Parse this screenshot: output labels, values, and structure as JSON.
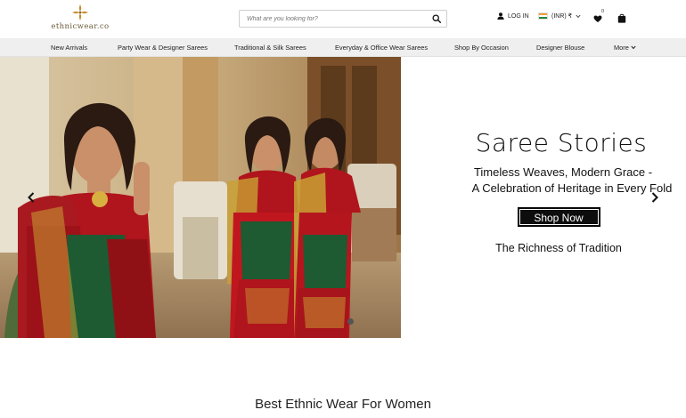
{
  "header": {
    "logo_text": "ethnicwear.co",
    "search_placeholder": "What are you looking for?",
    "login_label": "LOG IN",
    "currency_label": "(INR) ₹",
    "wishlist_count": "0",
    "icons": [
      "logo-mark",
      "search-icon",
      "user-icon",
      "india-flag-icon",
      "chevron-down-icon",
      "heart-icon",
      "shopping-bag-icon"
    ]
  },
  "nav": {
    "items": [
      {
        "label": "New Arrivals"
      },
      {
        "label": "Party Wear & Designer Sarees"
      },
      {
        "label": "Traditional & Silk Sarees"
      },
      {
        "label": "Everyday & Office Wear Sarees"
      },
      {
        "label": "Shop By Occasion"
      },
      {
        "label": "Designer Blouse"
      },
      {
        "label": "More"
      }
    ]
  },
  "hero": {
    "title": "Saree Stories",
    "subtitle_line1": "Timeless Weaves, Modern Grace -",
    "subtitle_line2": "A Celebration of Heritage in Every Fold",
    "button_label": "Shop Now",
    "tagline": "The Richness of Tradition",
    "slide_count": 1,
    "active_slide": 1
  },
  "section": {
    "title": "Best Ethnic Wear For Women"
  },
  "colors": {
    "nav_bg": "#efefef",
    "button_bg": "#0d0d0d",
    "saree_red": "#b0141c",
    "saree_green": "#1e5a32",
    "gold": "#c9a033"
  }
}
